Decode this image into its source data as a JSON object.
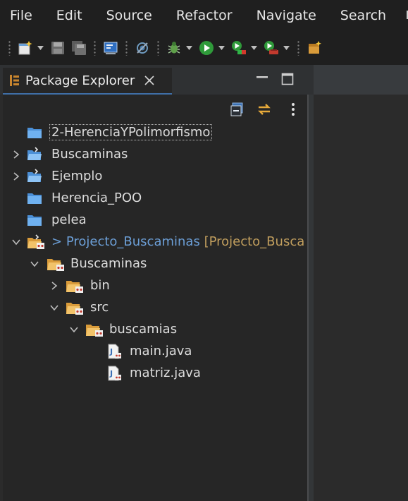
{
  "menu": [
    "File",
    "Edit",
    "Source",
    "Refactor",
    "Navigate",
    "Search"
  ],
  "toolbar": {
    "icons": [
      "new-wizard-icon",
      "save-icon",
      "save-all-icon",
      "open-console-icon",
      "skip-breakpoints-icon",
      "debug-icon",
      "run-icon",
      "coverage-icon",
      "external-tools-icon",
      "new-java-project-icon"
    ]
  },
  "panel": {
    "tab_label": "Package Explorer"
  },
  "tree": {
    "items": [
      {
        "label": "2-HerenciaYPolimorfismo",
        "type": "folder",
        "expandable": false,
        "expanded": false,
        "selected_focus": true
      },
      {
        "label": "Buscaminas",
        "type": "java-project",
        "expandable": true,
        "expanded": false
      },
      {
        "label": "Ejemplo",
        "type": "java-project",
        "expandable": true,
        "expanded": false
      },
      {
        "label": "Herencia_POO",
        "type": "folder",
        "expandable": false,
        "expanded": false
      },
      {
        "label": "pelea",
        "type": "folder",
        "expandable": false,
        "expanded": false
      },
      {
        "prefix": "> ",
        "label": "Projecto_Buscaminas",
        "suffix": "[Projecto_Busca",
        "type": "git-project",
        "expandable": true,
        "expanded": true
      },
      {
        "label": "Buscaminas",
        "type": "git-folder",
        "expandable": true,
        "expanded": true
      },
      {
        "label": "bin",
        "type": "git-folder",
        "expandable": true,
        "expanded": false
      },
      {
        "label": "src",
        "type": "git-folder",
        "expandable": true,
        "expanded": true
      },
      {
        "label": "buscamias",
        "type": "git-folder",
        "expandable": true,
        "expanded": true
      },
      {
        "label": "main.java",
        "type": "java-file",
        "expandable": false
      },
      {
        "label": "matriz.java",
        "type": "java-file",
        "expandable": false
      }
    ]
  },
  "colors": {
    "accent": "#3f6ea6",
    "project_link": "#6c9fd7",
    "repo_label": "#c29f5e",
    "background": "#262626"
  }
}
